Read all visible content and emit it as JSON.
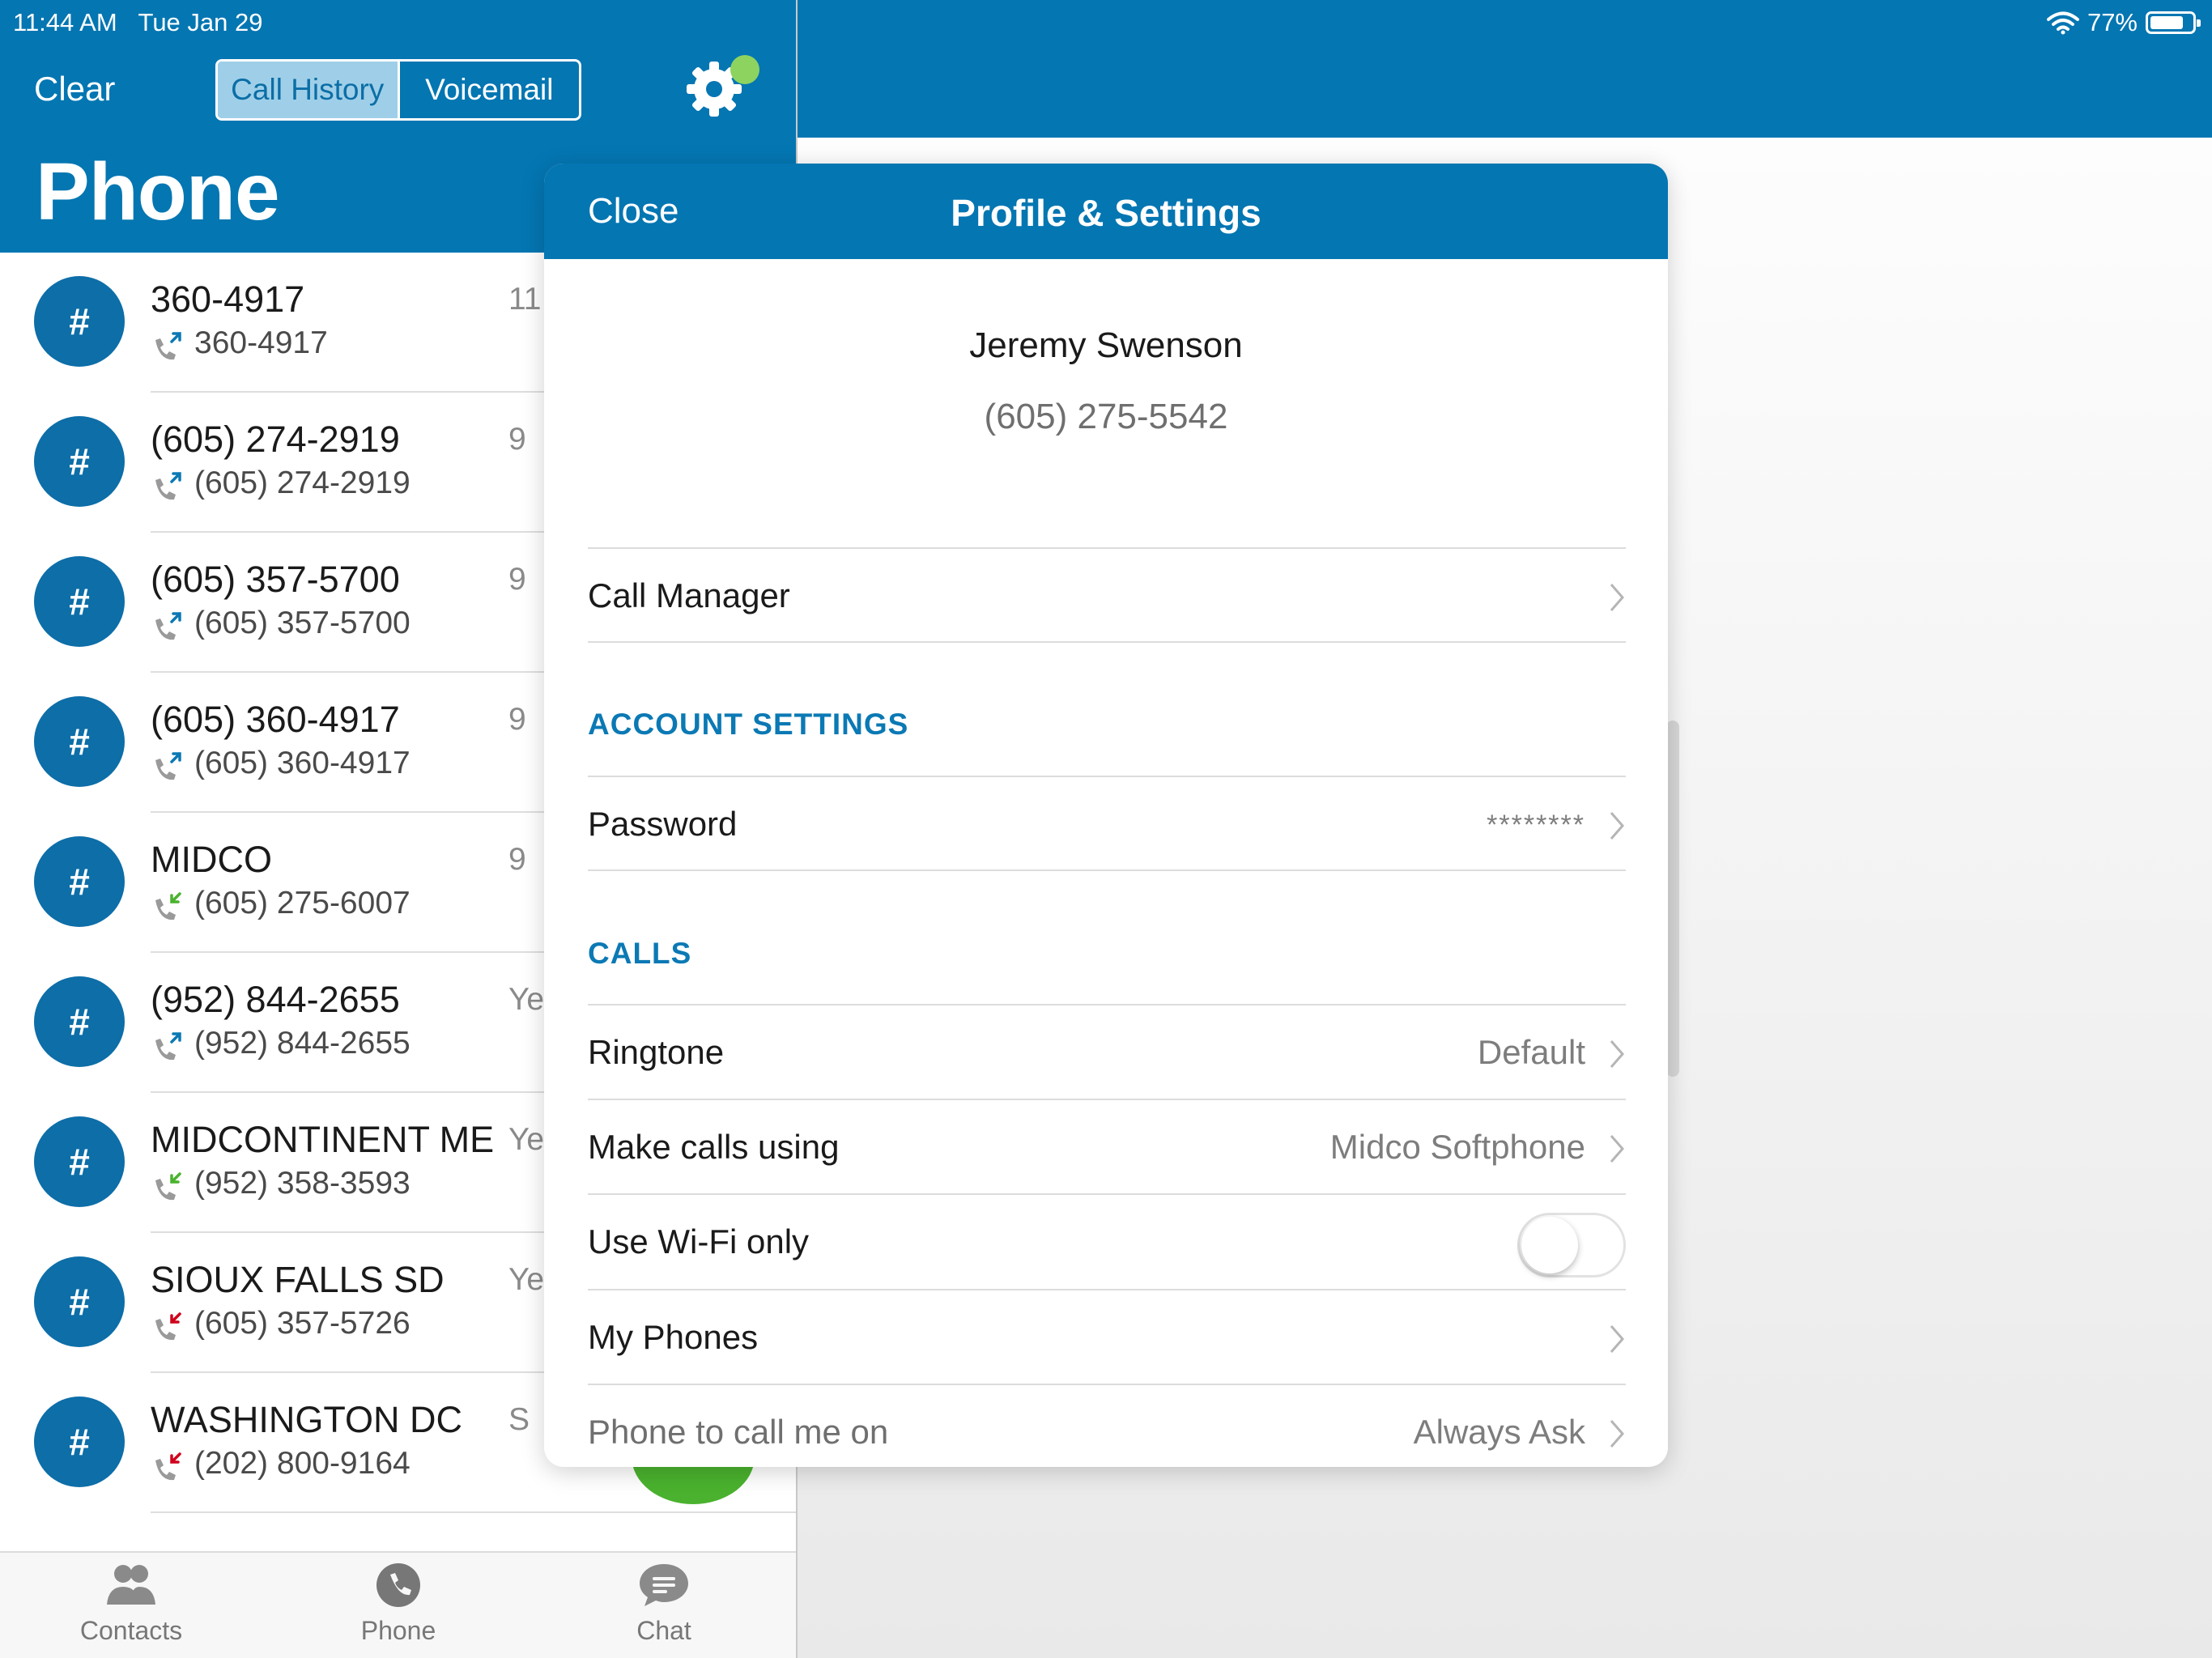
{
  "status_bar": {
    "time": "11:44 AM",
    "date": "Tue Jan 29",
    "battery": "77%",
    "battery_level": 0.77
  },
  "header": {
    "clear_label": "Clear",
    "segments": [
      {
        "label": "Call History",
        "active": true
      },
      {
        "label": "Voicemail",
        "active": false
      }
    ],
    "title": "Phone",
    "settings_icon": "gear-icon",
    "status_dot_color": "#8dd35f"
  },
  "calls": [
    {
      "name": "360-4917",
      "number": "360-4917",
      "time": "11",
      "direction": "outgoing"
    },
    {
      "name": "(605) 274-2919",
      "number": "(605) 274-2919",
      "time": "9",
      "direction": "outgoing"
    },
    {
      "name": "(605) 357-5700",
      "number": "(605) 357-5700",
      "time": "9",
      "direction": "outgoing"
    },
    {
      "name": "(605) 360-4917",
      "number": "(605) 360-4917",
      "time": "9",
      "direction": "outgoing"
    },
    {
      "name": "MIDCO",
      "number": "(605) 275-6007",
      "time": "9",
      "direction": "incoming"
    },
    {
      "name": "(952) 844-2655",
      "number": "(952) 844-2655",
      "time": "Ye",
      "direction": "outgoing"
    },
    {
      "name": "MIDCONTINENT ME",
      "number": "(952) 358-3593",
      "time": "Ye",
      "direction": "incoming"
    },
    {
      "name": "SIOUX FALLS  SD",
      "number": "(605) 357-5726",
      "time": "Ye",
      "direction": "missed"
    },
    {
      "name": "WASHINGTON   DC",
      "number": "(202) 800-9164",
      "time": "S",
      "direction": "missed"
    }
  ],
  "avatar_symbol": "#",
  "tabs": [
    {
      "label": "Contacts",
      "icon": "contacts-icon"
    },
    {
      "label": "Phone",
      "icon": "phone-icon"
    },
    {
      "label": "Chat",
      "icon": "chat-icon"
    }
  ],
  "modal": {
    "close_label": "Close",
    "title": "Profile & Settings",
    "profile": {
      "name": "Jeremy Swenson",
      "number": "(605) 275-5542"
    },
    "call_manager": "Call Manager",
    "account_section": "ACCOUNT SETTINGS",
    "password": {
      "label": "Password",
      "value": "********"
    },
    "calls_section": "CALLS",
    "ringtone": {
      "label": "Ringtone",
      "value": "Default"
    },
    "make_calls": {
      "label": "Make calls using",
      "value": "Midco Softphone"
    },
    "wifi_only": {
      "label": "Use Wi-Fi only",
      "on": false
    },
    "my_phones": "My Phones",
    "call_me_on": {
      "label": "Phone to call me on",
      "value": "Always Ask"
    }
  },
  "colors": {
    "brand_blue": "#0476b2",
    "avatar_blue": "#0d6ea8",
    "section_blue": "#0b79b4",
    "incoming": "#4ab22e",
    "missed": "#d0021b",
    "fab_green": "#4ab22e"
  }
}
